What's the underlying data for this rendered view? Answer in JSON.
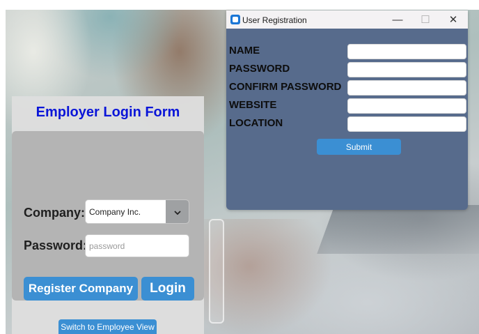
{
  "login": {
    "title": "Employer Login Form",
    "company_label": "Company:",
    "company_value": "Company Inc.",
    "password_label": "Password:",
    "password_placeholder": "password",
    "register_button": "Register Company",
    "login_button": "Login",
    "switch_button": "Switch to Employee View"
  },
  "registration": {
    "window_title": "User Registration",
    "minimize": "—",
    "maximize": "☐",
    "close": "✕",
    "fields": [
      {
        "label": "NAME",
        "value": ""
      },
      {
        "label": "PASSWORD",
        "value": ""
      },
      {
        "label": "CONFIRM PASSWORD",
        "value": ""
      },
      {
        "label": "WEBSITE",
        "value": ""
      },
      {
        "label": "LOCATION",
        "value": ""
      }
    ],
    "submit_button": "Submit"
  },
  "colors": {
    "title_blue": "#0a15d8",
    "button_blue": "#3b8fd3",
    "window_body": "#576b8c"
  }
}
